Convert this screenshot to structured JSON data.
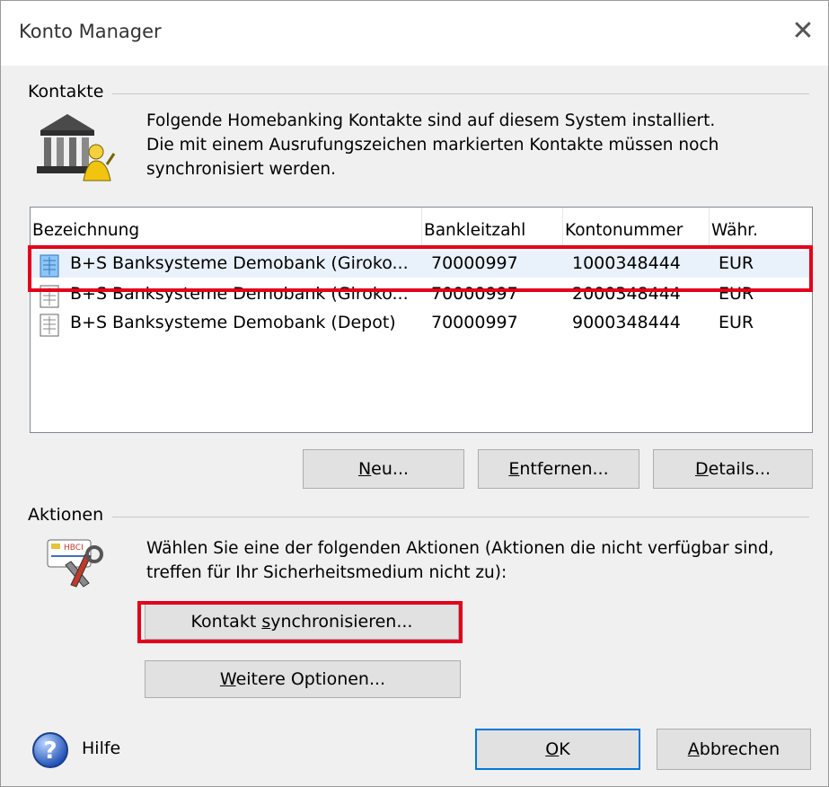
{
  "window": {
    "title": "Konto Manager",
    "close_glyph": "✕"
  },
  "kontakte": {
    "group_label": "Kontakte",
    "description": [
      "Folgende Homebanking Kontakte sind auf diesem System installiert.",
      "Die mit einem Ausrufungszeichen markierten Kontakte müssen noch",
      "synchronisiert werden."
    ],
    "icon": "bank-building-user-icon",
    "columns": [
      "Bezeichnung",
      "Bankleitzahl",
      "Kontonummer",
      "Währ."
    ],
    "rows": [
      {
        "name": "B+S Banksysteme Demobank  (Giroko...",
        "blz": "70000997",
        "konto": "1000348444",
        "currency": "EUR",
        "selected": true
      },
      {
        "name": "B+S Banksysteme Demobank  (Giroko...",
        "blz": "70000997",
        "konto": "2000348444",
        "currency": "EUR",
        "selected": false
      },
      {
        "name": "B+S Banksysteme Demobank  (Depot)",
        "blz": "70000997",
        "konto": "9000348444",
        "currency": "EUR",
        "selected": false
      }
    ],
    "buttons": {
      "neu": {
        "mnemonic": "N",
        "rest": "eu..."
      },
      "entfernen": {
        "mnemonic": "E",
        "rest": "ntfernen..."
      },
      "details": {
        "mnemonic": "D",
        "rest": "etails..."
      }
    }
  },
  "aktionen": {
    "group_label": "Aktionen",
    "icon": "hbci-card-tools-icon",
    "description": [
      "Wählen Sie eine der folgenden Aktionen (Aktionen die nicht verfügbar sind,",
      "treffen für Ihr Sicherheitsmedium nicht zu):"
    ],
    "sync_button": {
      "before": "Kontakt ",
      "mnemonic": "s",
      "after": "ynchronisieren..."
    },
    "more_button": {
      "mnemonic": "W",
      "after": "eitere Optionen..."
    }
  },
  "footer": {
    "help_label": "Hilfe",
    "help_icon": "help-question-icon",
    "ok_button": {
      "mnemonic": "O",
      "after": "K"
    },
    "cancel_button": {
      "mnemonic": "A",
      "after": "bbrechen"
    }
  },
  "colors": {
    "highlight_red": "#e3001b",
    "default_button_border": "#0078d7",
    "selection_bg": "#e9f1fb"
  }
}
